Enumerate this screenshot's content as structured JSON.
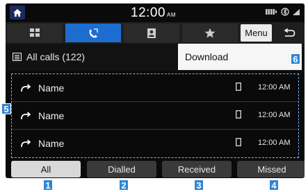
{
  "status_bar": {
    "time": "12:00",
    "ampm": "AM"
  },
  "tabs": [
    {
      "name": "keypad-icon",
      "active": false
    },
    {
      "name": "phone-recent-icon",
      "active": true
    },
    {
      "name": "contacts-icon",
      "active": false
    },
    {
      "name": "favorites-star-icon",
      "active": false
    }
  ],
  "toolbar": {
    "menu_label": "Menu"
  },
  "header": {
    "all_calls_label": "All calls (122)",
    "download_label": "Download"
  },
  "calls": [
    {
      "name": "Name",
      "time": "12:00 AM"
    },
    {
      "name": "Name",
      "time": "12:00 AM"
    },
    {
      "name": "Name",
      "time": "12:00 AM"
    }
  ],
  "filters": [
    {
      "label": "All",
      "active": true
    },
    {
      "label": "Dialled",
      "active": false
    },
    {
      "label": "Received",
      "active": false
    },
    {
      "label": "Missed",
      "active": false
    }
  ],
  "markers": [
    "1",
    "2",
    "3",
    "4",
    "5",
    "6"
  ],
  "colors": {
    "accent_blue": "#1d6dd1",
    "marker_blue": "#2f86d6",
    "background": "#0a0a0a"
  }
}
